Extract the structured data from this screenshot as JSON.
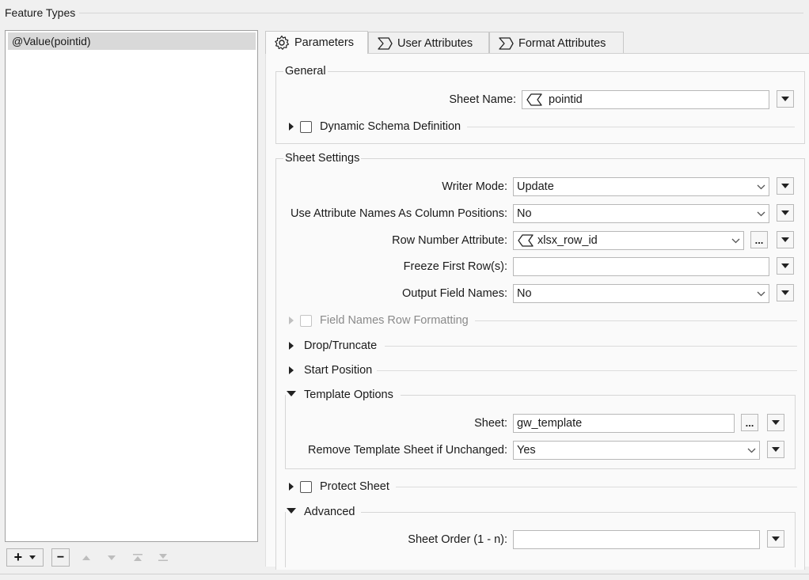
{
  "panel_title": "Feature Types",
  "feature_types": [
    {
      "label": "@Value(pointid)",
      "selected": true
    }
  ],
  "toolbar": {
    "add": "+",
    "remove": "−"
  },
  "tabs": [
    {
      "label": "Parameters",
      "icon": "gear-icon",
      "active": true
    },
    {
      "label": "User Attributes",
      "icon": "sigma-icon",
      "active": false
    },
    {
      "label": "Format Attributes",
      "icon": "sigma-icon",
      "active": false
    }
  ],
  "general": {
    "title": "General",
    "sheet_name": {
      "label": "Sheet Name:",
      "value": "pointid"
    },
    "dynamic_schema": {
      "label": "Dynamic Schema Definition",
      "checked": false
    }
  },
  "sheet_settings": {
    "title": "Sheet Settings",
    "writer_mode": {
      "label": "Writer Mode:",
      "value": "Update"
    },
    "use_attr_names": {
      "label": "Use Attribute Names As Column Positions:",
      "value": "No"
    },
    "row_number_attr": {
      "label": "Row Number Attribute:",
      "value": "xlsx_row_id"
    },
    "freeze_first_rows": {
      "label": "Freeze First Row(s):",
      "value": ""
    },
    "output_field_names": {
      "label": "Output Field Names:",
      "value": "No"
    },
    "field_names_row_formatting": {
      "label": "Field Names Row Formatting",
      "enabled": false
    },
    "drop_truncate": {
      "label": "Drop/Truncate"
    },
    "start_position": {
      "label": "Start Position"
    },
    "template_options": {
      "label": "Template Options",
      "sheet": {
        "label": "Sheet:",
        "value": "gw_template"
      },
      "remove_template": {
        "label": "Remove Template Sheet if Unchanged:",
        "value": "Yes"
      }
    },
    "protect_sheet": {
      "label": "Protect Sheet",
      "checked": false
    },
    "advanced": {
      "label": "Advanced",
      "sheet_order": {
        "label": "Sheet Order (1 - n):",
        "value": ""
      }
    }
  },
  "colors": {
    "selection": "#d9d9d9",
    "background": "#f0f0f0",
    "pane": "#fafafa"
  }
}
